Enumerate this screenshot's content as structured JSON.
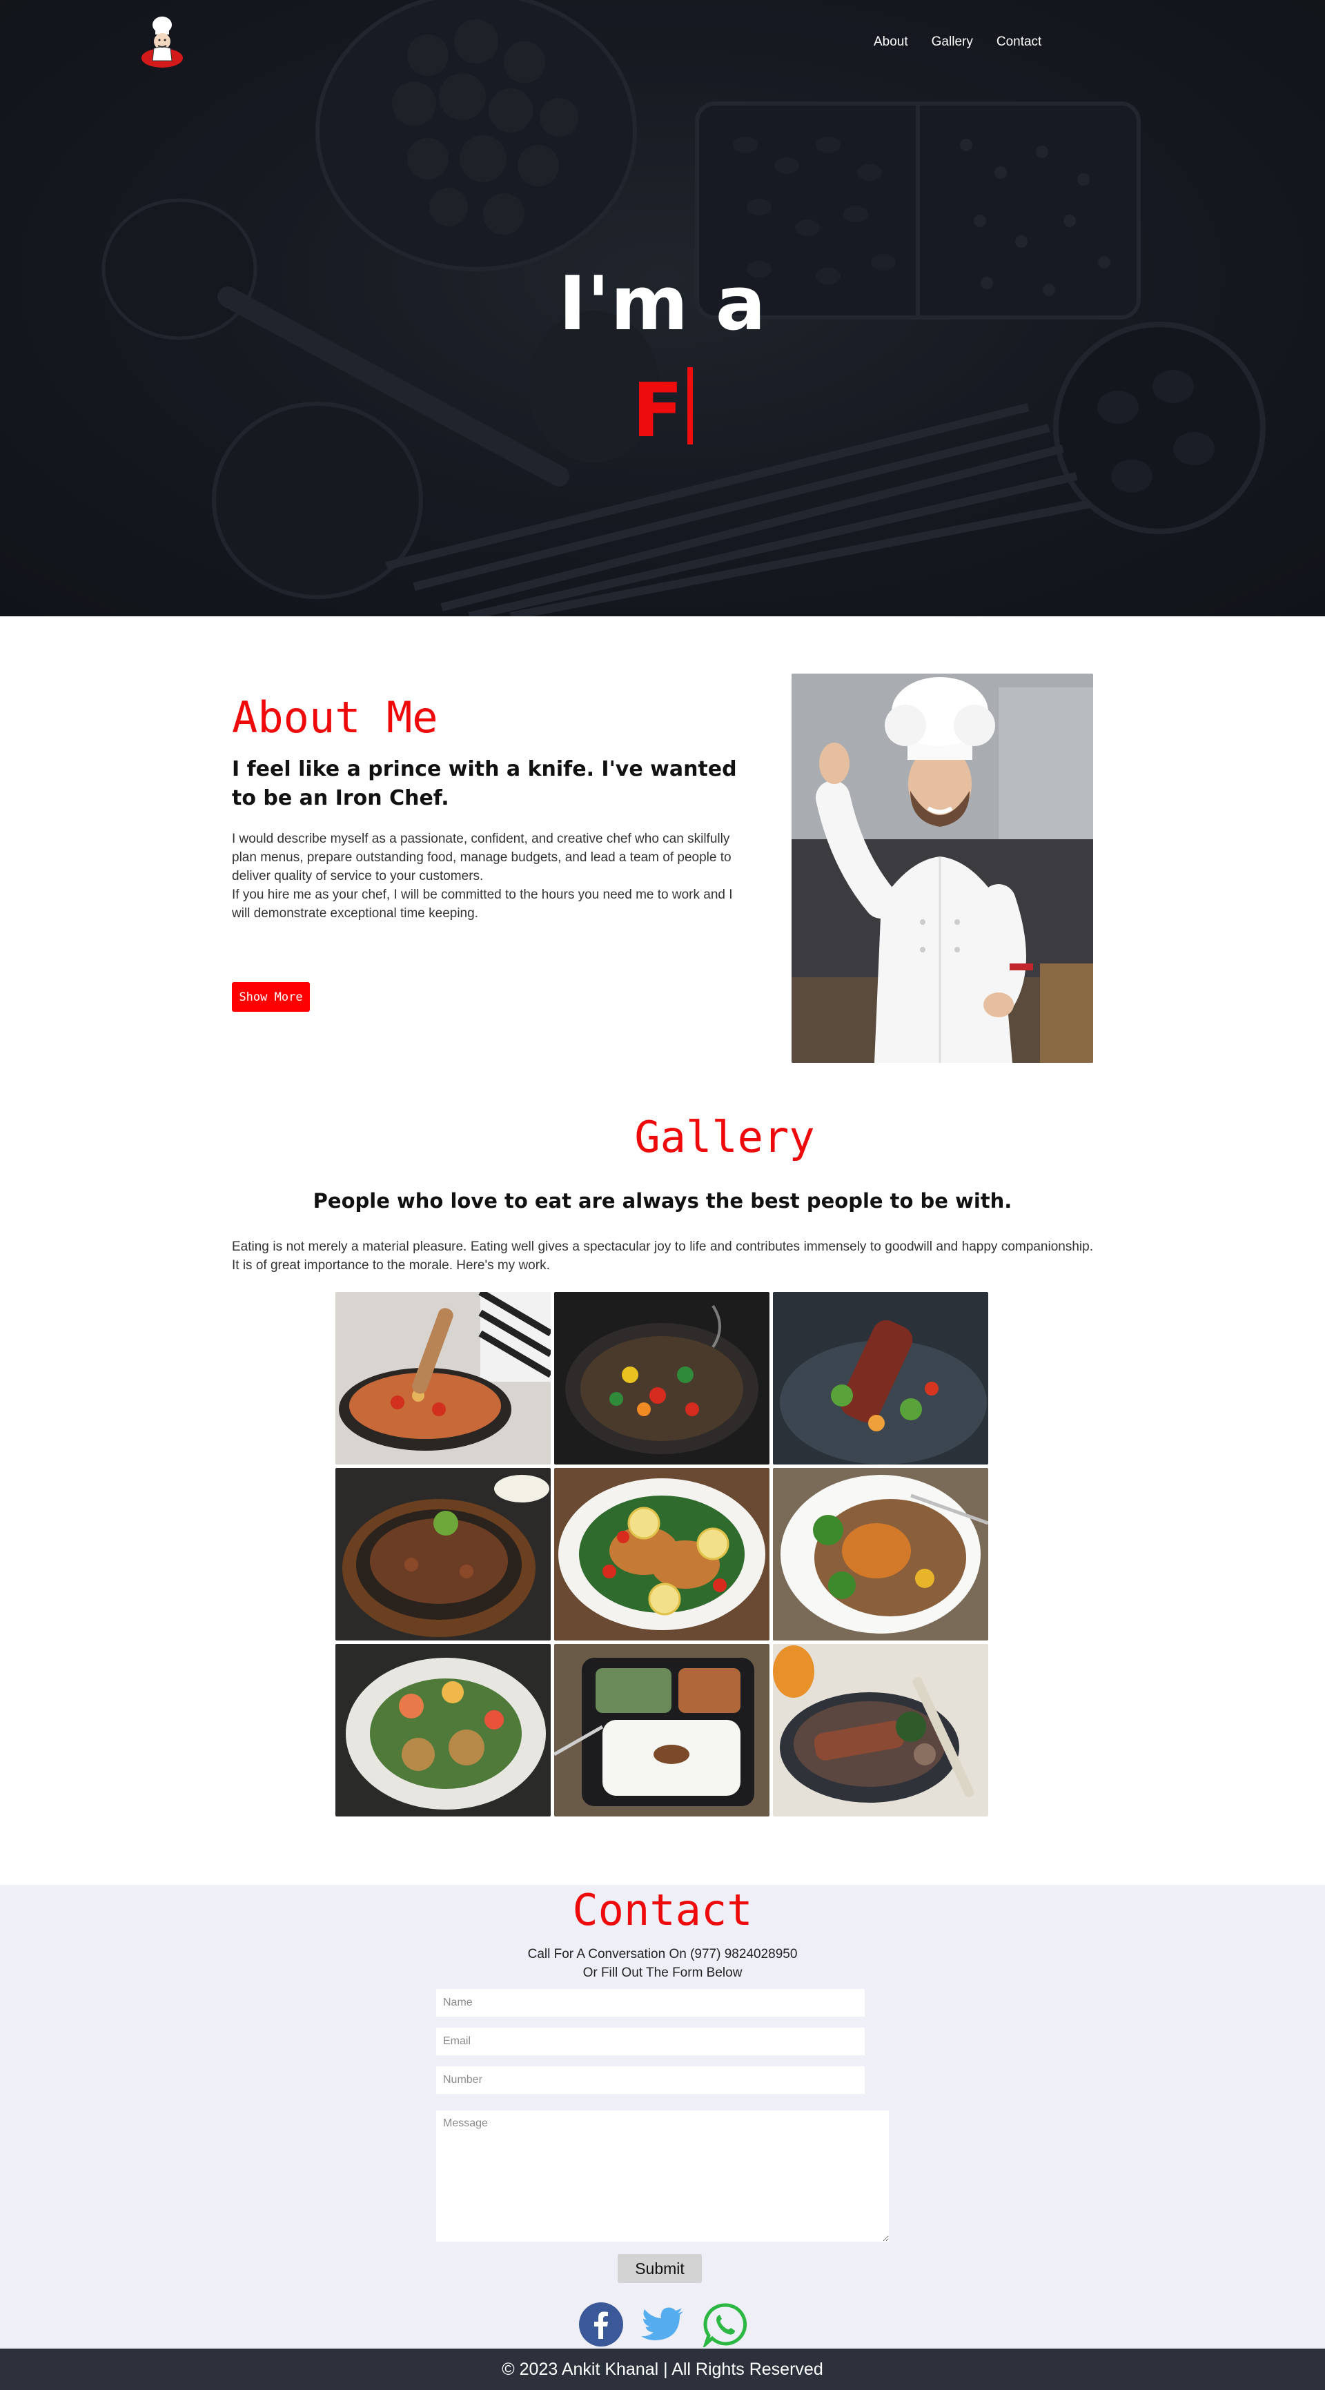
{
  "nav": {
    "links": [
      "About",
      "Gallery",
      "Contact"
    ]
  },
  "hero": {
    "title": "I'm a",
    "typed": "F"
  },
  "about": {
    "title": "About Me",
    "subtitle": "I feel like a prince with a knife. I've wanted to be an Iron Chef.",
    "body_1": "I would describe myself as a passionate, confident, and creative chef who can skilfully plan menus, prepare outstanding food, manage budgets, and lead a team of people to deliver quality of service to your customers.",
    "body_2": "If you hire me as your chef, I will be committed to the hours you need me to work and I will demonstrate exceptional time keeping.",
    "button": "Show More"
  },
  "gallery": {
    "title": "Gallery",
    "subtitle": "People who love to eat are always the best people to be with.",
    "body": "Eating is not merely a material pleasure. Eating well gives a spectacular joy to life and contributes immensely to goodwill and happy companionship. It is of great importance to the morale. Here's my work."
  },
  "contact": {
    "title": "Contact",
    "line_1": "Call For A Conversation On (977) 9824028950",
    "line_2": "Or Fill Out The Form Below",
    "placeholders": {
      "name": "Name",
      "email": "Email",
      "number": "Number",
      "message": "Message"
    },
    "submit": "Submit"
  },
  "socials": [
    "facebook-icon",
    "twitter-icon",
    "whatsapp-icon"
  ],
  "footer": {
    "text": "© 2023 Ankit Khanal | All Rights Reserved"
  },
  "colors": {
    "accent": "#ef0c0c",
    "contact_bg": "#efeff8",
    "footer_bg": "#2c313c"
  }
}
